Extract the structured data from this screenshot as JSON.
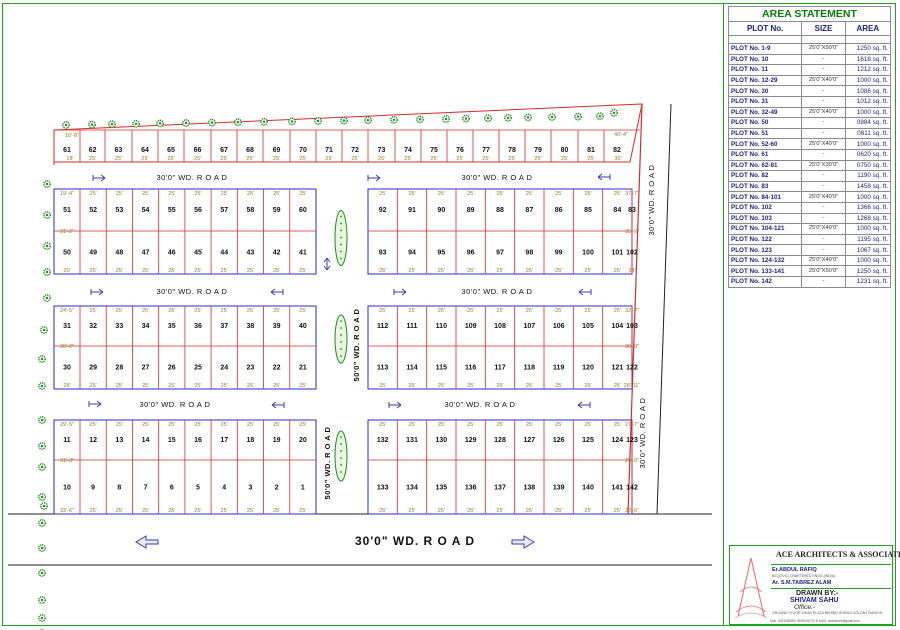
{
  "area_statement": {
    "title": "AREA STATEMENT",
    "headers": [
      "PLOT No.",
      "SIZE",
      "AREA"
    ],
    "rows": [
      [
        "PLOT No. 1-9",
        "25'0\"X50'0\"",
        "1250 sq. ft."
      ],
      [
        "PLOT No. 10",
        "-",
        "1618 sq. ft."
      ],
      [
        "PLOT No. 11",
        "-",
        "1212 sq. ft."
      ],
      [
        "PLOT No. 12-29",
        "25'0\"X40'0\"",
        "1000 sq. ft."
      ],
      [
        "PLOT No. 30",
        "-",
        "1086 sq. ft."
      ],
      [
        "PLOT No. 31",
        "-",
        "1012 sq. ft."
      ],
      [
        "PLOT No. 32-49",
        "25'0\"X40'0\"",
        "1000 sq. ft."
      ],
      [
        "PLOT No. 50",
        "-",
        "0884 sq. ft."
      ],
      [
        "PLOT No. 51",
        "-",
        "0811 sq. ft."
      ],
      [
        "PLOT No. 52-60",
        "25'0\"X40'0\"",
        "1000 sq. ft."
      ],
      [
        "PLOT No. 61",
        "-",
        "0620 sq. ft."
      ],
      [
        "PLOT No. 62-81",
        "25'0\"X30'0\"",
        "0750 sq. ft."
      ],
      [
        "PLOT No. 82",
        "-",
        "1190 sq. ft."
      ],
      [
        "PLOT No. 83",
        "-",
        "1458 sq. ft."
      ],
      [
        "PLOT No. 84-101",
        "25'0\"X40'0\"",
        "1000 sq. ft."
      ],
      [
        "PLOT No. 102",
        "-",
        "1366 sq. ft."
      ],
      [
        "PLOT No. 103",
        "-",
        "1268 sq. ft."
      ],
      [
        "PLOT No. 104-121",
        "25'0\"X40'0\"",
        "1000 sq. ft."
      ],
      [
        "PLOT No. 122",
        "-",
        "1195 sq. ft."
      ],
      [
        "PLOT No. 123",
        "-",
        "1067 sq. ft."
      ],
      [
        "PLOT No. 124-132",
        "25'0\"X40'0\"",
        "1000 sq. ft."
      ],
      [
        "PLOT No. 133-141",
        "25'0\"X50'0\"",
        "1250 sq. ft."
      ],
      [
        "PLOT No. 142",
        "-",
        "1231 sq. ft."
      ]
    ]
  },
  "title_block": {
    "firm": "ACE ARCHITECTS & ASSOCIATES",
    "partner1": "Er.ABDUL RAFIQ",
    "partner1_sub": "B.E(CIVIL) CHARTERED ENGG.(INDIA)",
    "partner2": "Ar. S.M.TABREZ ALAM",
    "drawn_by": "DRAWN BY:-",
    "drawer": "SHIVAM SAHU",
    "office": "Office:-",
    "address": "GROUND FLOOR VIKAS PLAZA BEHIND SHIVAJI COLONY RANCHI",
    "footer": "Mob. 9431160553, 9939441074 E-MAIL: aceranchi@gmail.com"
  },
  "roads": {
    "main": "30'0\"  WD.  R O A D",
    "h1_left": "30'0\"  WD.  R O A D",
    "h1_right": "30'0\"  WD.  R O A D",
    "h2_left": "30'0\"  WD.  R O A D",
    "h2_right": "30'0\"  WD.  R O A D",
    "h3_left": "30'0\"  WD.  R O A D",
    "h3_right": "30'0\"  WD.  R O A D",
    "v_center_upper": "50'0\"  WD.  R O A D",
    "v_center_lower": "50'0\"  WD.  R O A D",
    "v_right_upper": "30'0\"  WD.  R O A D",
    "v_right_lower": "30'0\"  WD.  R O A D"
  },
  "dims": {
    "d25": "25'",
    "r1_left_top": "16'-8\"",
    "r1_left_bot": "18'",
    "r1_right_top": "40'-4\"",
    "r1_right_bot": "30'",
    "b1_left_top": "19'-4\"",
    "b1_left_mid": "21'-2\"",
    "b1_left_bot": "20'",
    "b1_right_top": "37'-7\"",
    "b1_right_mid": "35'-9\"",
    "b1_right_bot": "34'",
    "b2_left_top": "24'-5\"",
    "b2_left_mid": "26'-2\"",
    "b2_left_bot": "28'",
    "b2_right_top": "32'-7\"",
    "b2_right_mid": "30'-9\"",
    "b2_right_bot": "28'-11\"",
    "b3_left_top": "29'-5\"",
    "b3_left_mid": "31'-3\"",
    "b3_left_bot": "33'-6\"",
    "b3_right_top": "27'-7\"",
    "b3_right_mid": "25'-9\"",
    "b3_right_bot": "23'-6\""
  },
  "blocks": {
    "row1": [
      "61",
      "62",
      "63",
      "64",
      "65",
      "66",
      "67",
      "68",
      "69",
      "70",
      "71",
      "72",
      "73",
      "74",
      "75",
      "76",
      "77",
      "78",
      "79",
      "80",
      "81",
      "82"
    ],
    "b1_left_top": [
      "51",
      "52",
      "53",
      "54",
      "55",
      "56",
      "57",
      "58",
      "59",
      "60"
    ],
    "b1_left_bot": [
      "50",
      "49",
      "48",
      "47",
      "46",
      "45",
      "44",
      "43",
      "42",
      "41"
    ],
    "b1_right_top": [
      "92",
      "91",
      "90",
      "89",
      "88",
      "87",
      "86",
      "85",
      "84",
      "83"
    ],
    "b1_right_bot": [
      "93",
      "94",
      "95",
      "96",
      "97",
      "98",
      "99",
      "100",
      "101",
      "102"
    ],
    "b2_left_top": [
      "31",
      "32",
      "33",
      "34",
      "35",
      "36",
      "37",
      "38",
      "39",
      "40"
    ],
    "b2_left_bot": [
      "30",
      "29",
      "28",
      "27",
      "26",
      "25",
      "24",
      "23",
      "22",
      "21"
    ],
    "b2_right_top": [
      "112",
      "111",
      "110",
      "109",
      "108",
      "107",
      "106",
      "105",
      "104",
      "103"
    ],
    "b2_right_bot": [
      "113",
      "114",
      "115",
      "116",
      "117",
      "118",
      "119",
      "120",
      "121",
      "122"
    ],
    "b3_left_top": [
      "11",
      "12",
      "13",
      "14",
      "15",
      "16",
      "17",
      "18",
      "19",
      "20"
    ],
    "b3_left_bot": [
      "10",
      "9",
      "8",
      "7",
      "6",
      "5",
      "4",
      "3",
      "2",
      "1"
    ],
    "b3_right_top": [
      "132",
      "131",
      "130",
      "129",
      "128",
      "127",
      "126",
      "125",
      "124",
      "123"
    ],
    "b3_right_bot": [
      "133",
      "134",
      "135",
      "136",
      "137",
      "138",
      "139",
      "140",
      "141",
      "142"
    ]
  },
  "colors": {
    "frame": "#1fa31f",
    "plot_line": "#d92b2b",
    "block_outline": "#2a2ad6",
    "road_text": "#111111",
    "dim_text": "#9a7a2a",
    "tree": "#1d8a1d",
    "arrow": "#3b3bbd"
  }
}
